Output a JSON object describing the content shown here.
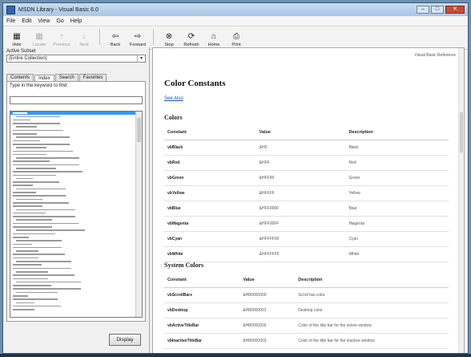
{
  "window": {
    "title": "MSDN Library - Visual Basic 6.0",
    "controls": {
      "minimize": "–",
      "maximize": "□",
      "close": "✕"
    }
  },
  "menu": [
    "File",
    "Edit",
    "View",
    "Go",
    "Help"
  ],
  "toolbar": [
    {
      "label": "Hide",
      "icon": "hide-icon",
      "glyph": "▦",
      "disabled": false
    },
    {
      "label": "Locate",
      "icon": "locate-icon",
      "glyph": "▦",
      "disabled": true
    },
    {
      "label": "Previous",
      "icon": "previous-icon",
      "glyph": "↑",
      "disabled": true
    },
    {
      "label": "Next",
      "icon": "next-icon",
      "glyph": "↓",
      "disabled": true
    },
    {
      "label": "Back",
      "icon": "back-icon",
      "glyph": "⇦",
      "disabled": false
    },
    {
      "label": "Forward",
      "icon": "forward-icon",
      "glyph": "⇨",
      "disabled": false
    },
    {
      "label": "Stop",
      "icon": "stop-icon",
      "glyph": "⊗",
      "disabled": false
    },
    {
      "label": "Refresh",
      "icon": "refresh-icon",
      "glyph": "⟳",
      "disabled": false
    },
    {
      "label": "Home",
      "icon": "home-icon",
      "glyph": "⌂",
      "disabled": false
    },
    {
      "label": "Print",
      "icon": "print-icon",
      "glyph": "⎙",
      "disabled": false
    }
  ],
  "left": {
    "active_subset_label": "Active Subset",
    "subset_value": "(Entire Collection)",
    "tabs": [
      "Contents",
      "Index",
      "Search",
      "Favorites"
    ],
    "active_tab": 1,
    "keyword_label": "Type in the keyword to find:",
    "keyword_value": "",
    "display_button": "Display"
  },
  "right": {
    "breadcrumb": "Visual Basic Reference",
    "title": "Color Constants",
    "see_also": "See Also",
    "colors_heading": "Colors",
    "system_colors_heading": "System Colors",
    "columns": [
      "Constant",
      "Value",
      "Description"
    ],
    "colors": [
      [
        "vbBlack",
        "&H0",
        "Black"
      ],
      [
        "vbRed",
        "&HFF",
        "Red"
      ],
      [
        "vbGreen",
        "&HFF00",
        "Green"
      ],
      [
        "vbYellow",
        "&HFFFF",
        "Yellow"
      ],
      [
        "vbBlue",
        "&HFF0000",
        "Blue"
      ],
      [
        "vbMagenta",
        "&HFF00FF",
        "Magenta"
      ],
      [
        "vbCyan",
        "&HFFFF00",
        "Cyan"
      ],
      [
        "vbWhite",
        "&HFFFFFF",
        "White"
      ]
    ],
    "system_colors": [
      [
        "vbScrollBars",
        "&H80000000",
        "Scroll bar color"
      ],
      [
        "vbDesktop",
        "&H80000001",
        "Desktop color"
      ],
      [
        "vbActiveTitleBar",
        "&H80000002",
        "Color of the title bar for the active window"
      ],
      [
        "vbInactiveTitleBar",
        "&H80000003",
        "Color of the title bar for the inactive window"
      ]
    ]
  },
  "colors": {
    "title_bar": "#a8c6e6",
    "selection": "#3399ff",
    "link": "#1a4fb3"
  }
}
